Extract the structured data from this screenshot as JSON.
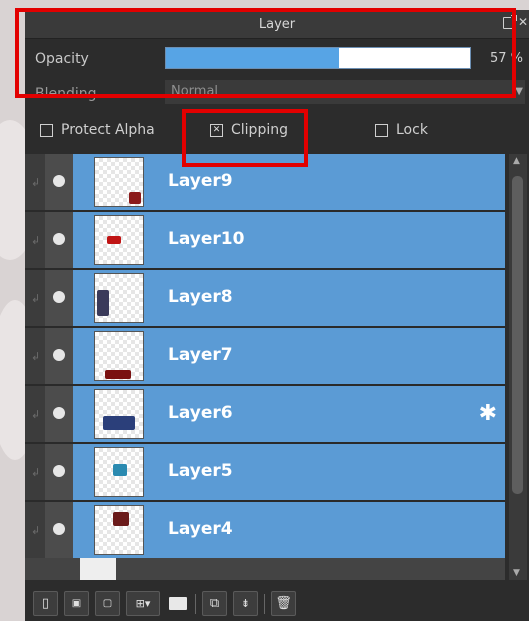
{
  "panel": {
    "title": "Layer"
  },
  "opacity": {
    "label": "Opacity",
    "value_text": "57 %",
    "fraction": 0.57
  },
  "blending": {
    "label": "Blending",
    "value": "Normal"
  },
  "options": {
    "protect_alpha": {
      "label": "Protect Alpha",
      "checked": false
    },
    "clipping": {
      "label": "Clipping",
      "checked": true
    },
    "lock": {
      "label": "Lock",
      "checked": false
    }
  },
  "layers": [
    {
      "name": "Layer9",
      "selected": true
    },
    {
      "name": "Layer10",
      "selected": true
    },
    {
      "name": "Layer8",
      "selected": true
    },
    {
      "name": "Layer7",
      "selected": true
    },
    {
      "name": "Layer6",
      "selected": true,
      "settings_icon": "gear-icon"
    },
    {
      "name": "Layer5",
      "selected": true
    },
    {
      "name": "Layer4",
      "selected": true
    }
  ],
  "colors": {
    "selection": "#5b9bd5",
    "highlight": "#e20000",
    "panel_bg": "#2c2c2c"
  },
  "toolbar": {
    "icons": [
      "new-layer-icon",
      "new-8bit-layer-icon",
      "new-1bit-layer-icon",
      "add-layer-dropdown-icon",
      "folder-icon",
      "duplicate-layer-icon",
      "merge-layer-icon",
      "delete-layer-icon"
    ]
  }
}
